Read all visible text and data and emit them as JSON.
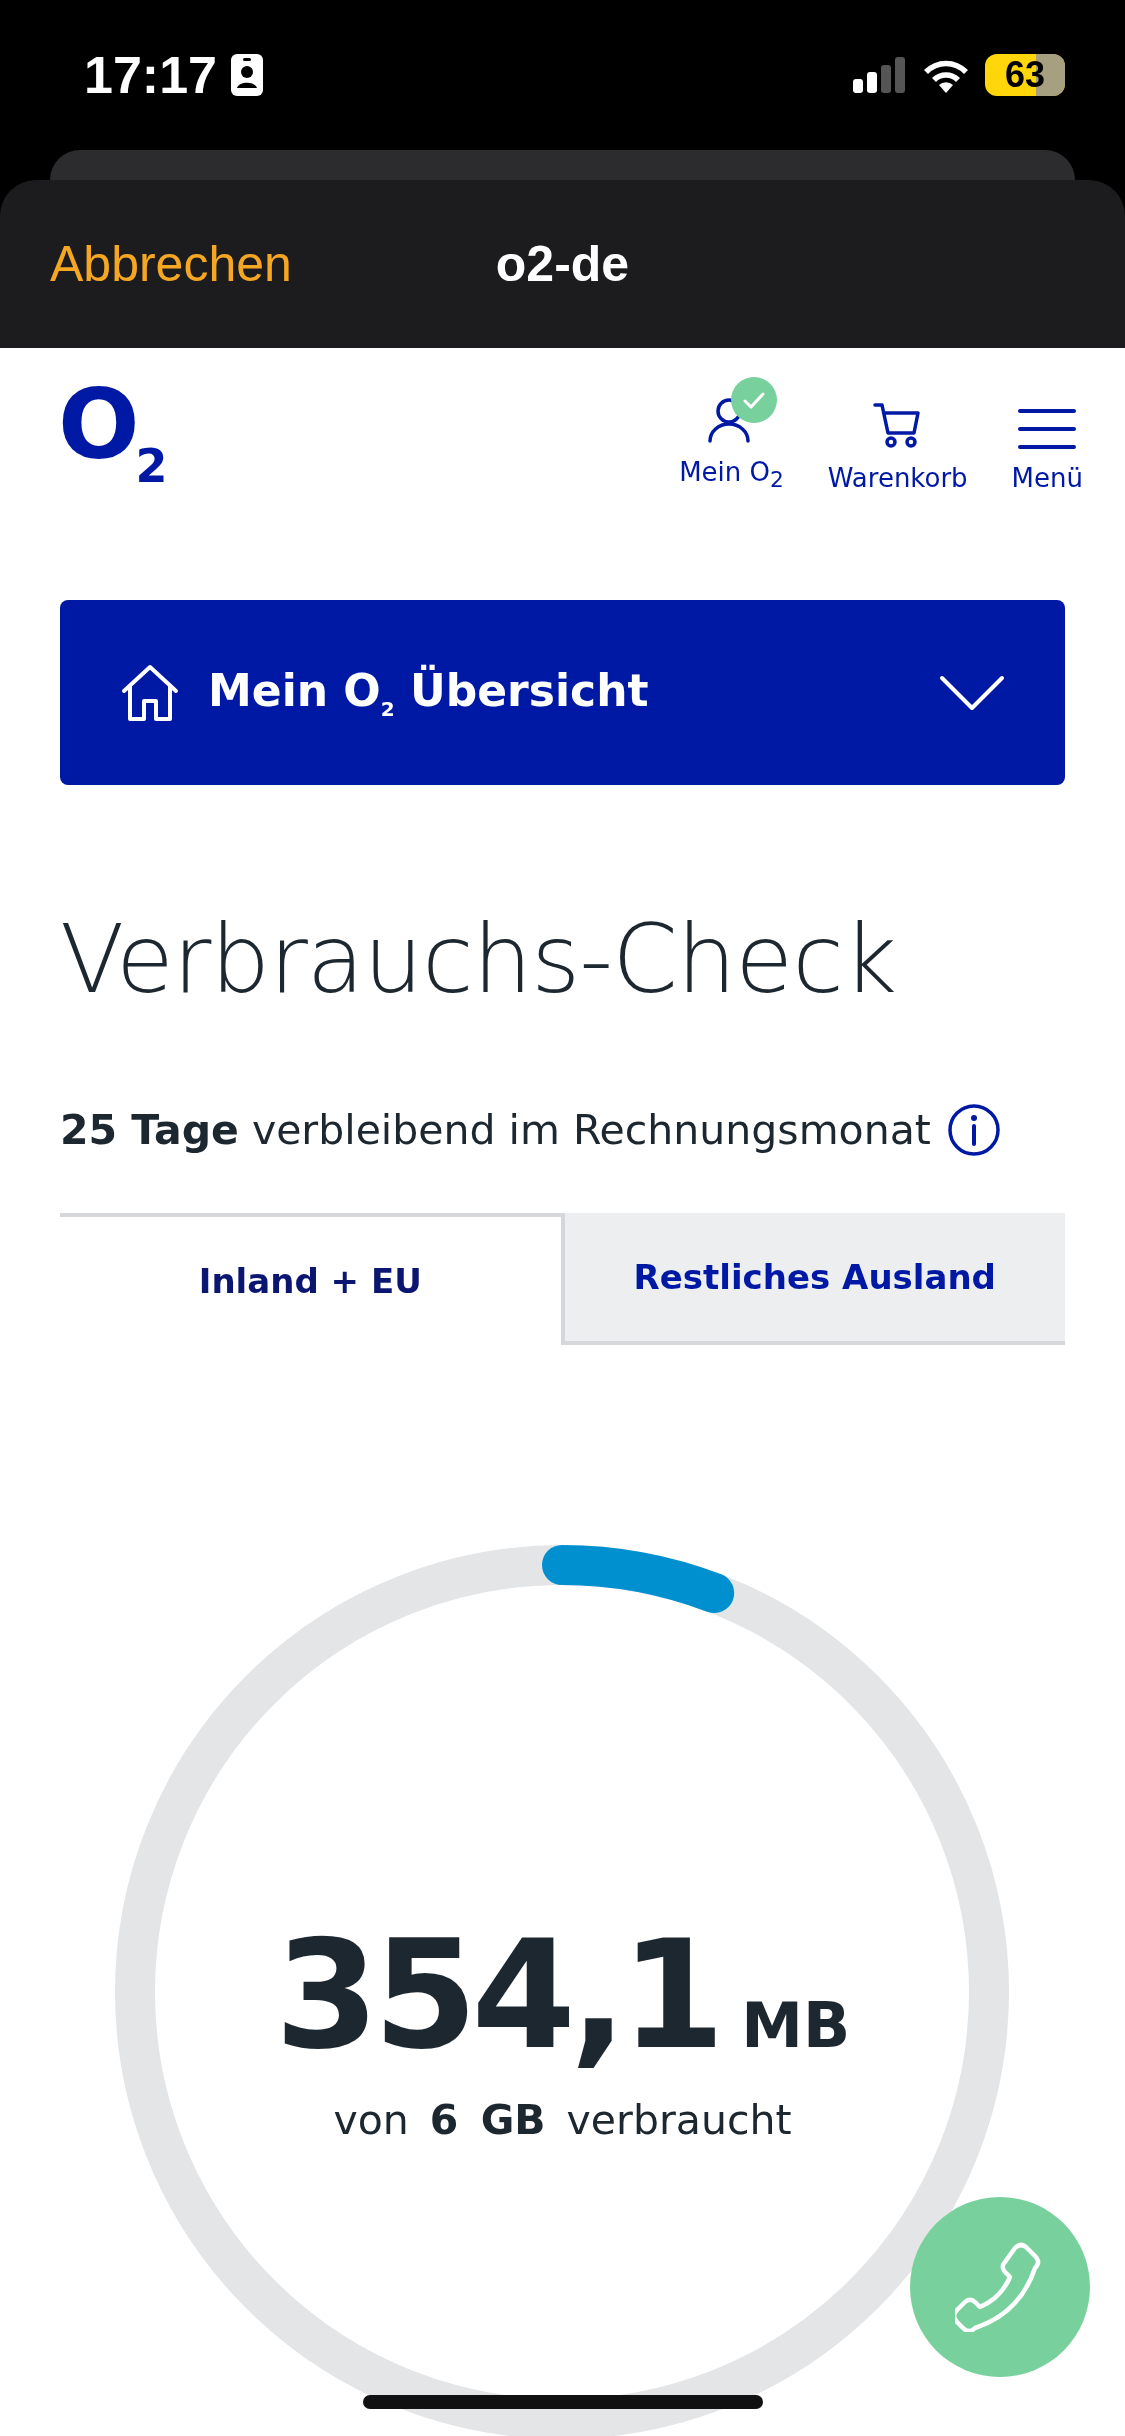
{
  "status_bar": {
    "time": "17:17",
    "battery": "63"
  },
  "sheet": {
    "cancel": "Abbrechen",
    "title": "o2-de"
  },
  "header": {
    "logo": "O$_{2}$",
    "nav": [
      {
        "kind": "account",
        "label": "Mein O$_{2}$"
      },
      {
        "kind": "cart",
        "label": "Warenkorb"
      },
      {
        "kind": "menu",
        "label": "Menü"
      }
    ]
  },
  "overview": {
    "label": "Mein O$_{2}$ Übersicht"
  },
  "heading": "Verbrauchs-Check",
  "remaining": "**25 Tage** verbleibend im Rechnungsmonat",
  "tabs": [
    {
      "label": "Inland + EU",
      "selected": true
    },
    {
      "label": "Restliches Ausland",
      "selected": false
    }
  ],
  "usage": {
    "value": "354,1",
    "unit": "MB",
    "caption": "von **6 GB** verbraucht",
    "level": 0.058
  }
}
